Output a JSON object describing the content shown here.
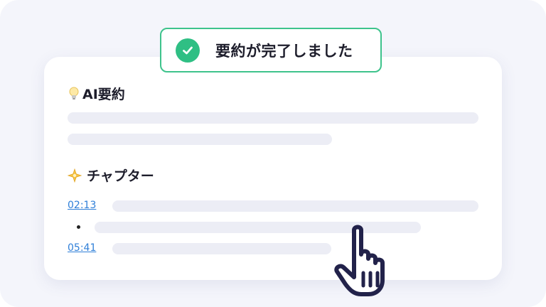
{
  "toast": {
    "message": "要約が完了しました",
    "icon": "check-circle-icon",
    "accent": "#2fbf84"
  },
  "summary": {
    "title": "AI要約",
    "icon": "lightbulb-icon"
  },
  "chapters": {
    "title": "チャプター",
    "icon": "sparkle-star-icon",
    "items": [
      {
        "time": "02:13"
      },
      {
        "time": ""
      },
      {
        "time": "05:41"
      }
    ]
  },
  "link_color": "#2f7fd8",
  "cursor": {
    "icon": "hand-pointer-icon"
  }
}
